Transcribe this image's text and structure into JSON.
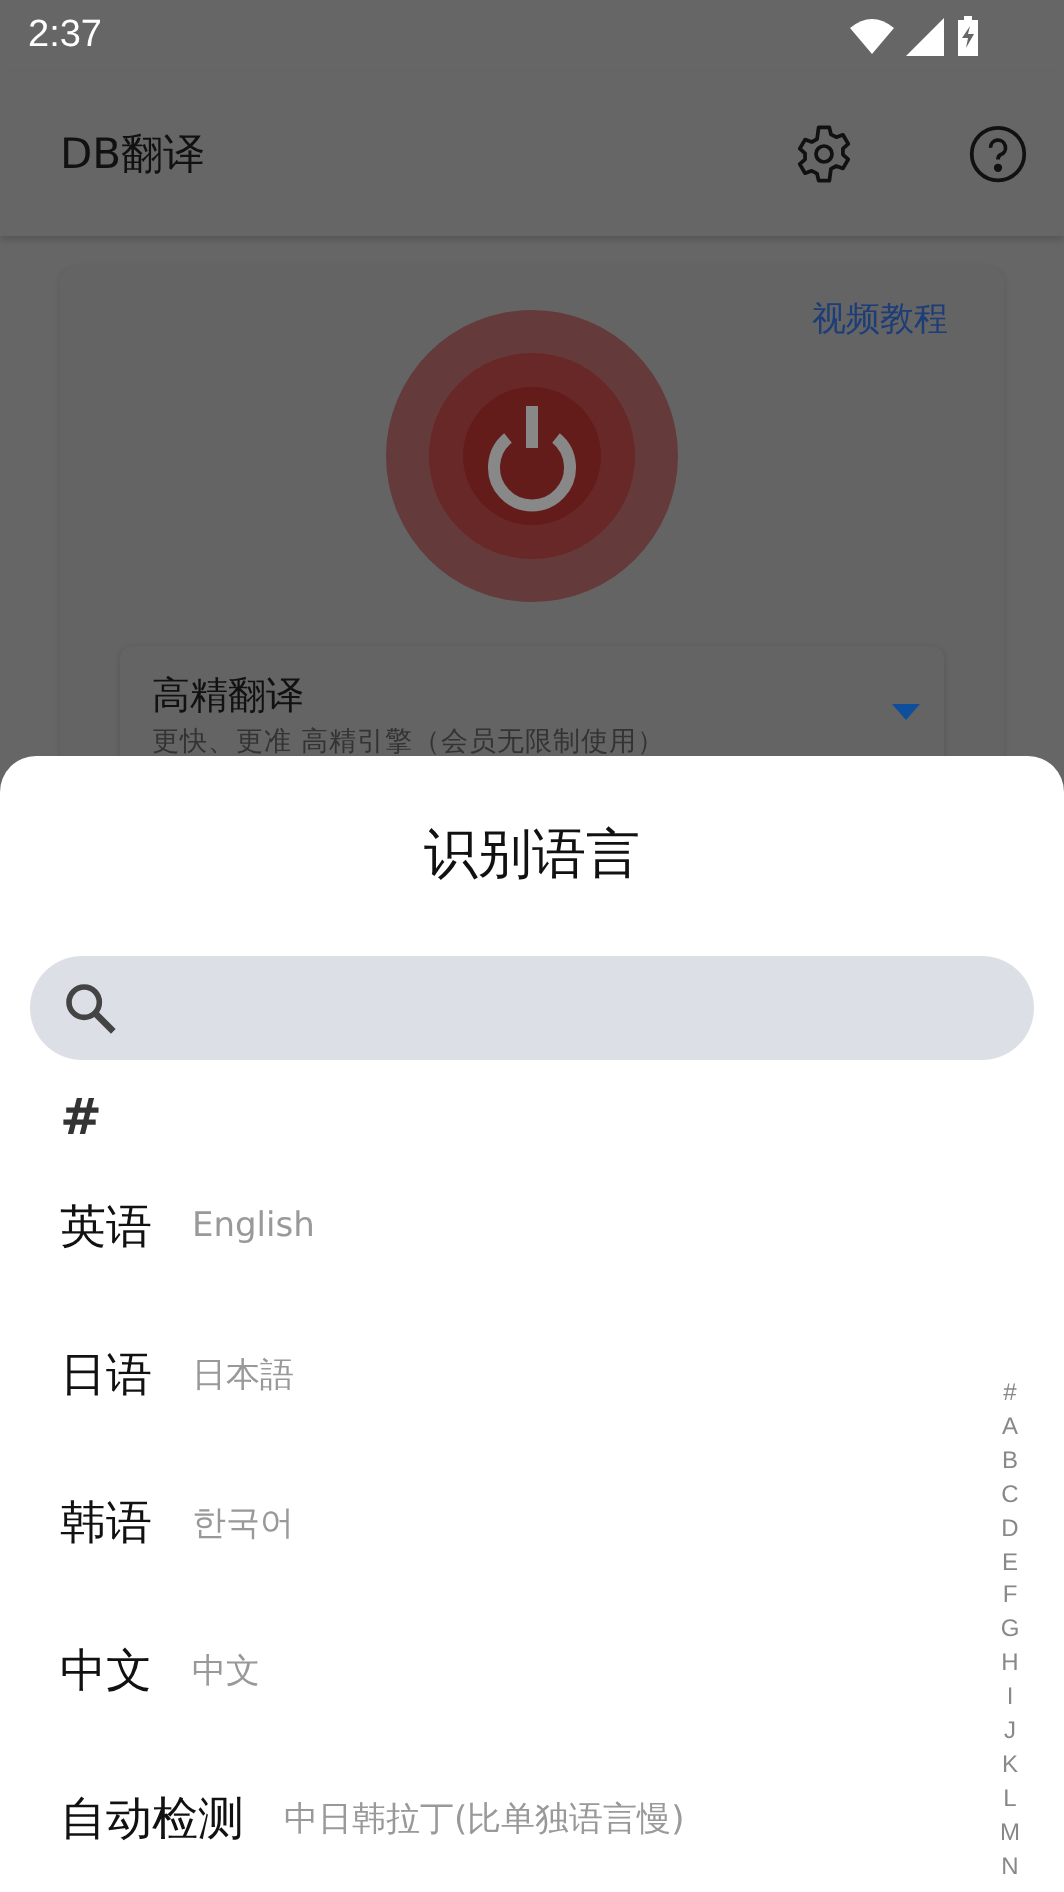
{
  "status_bar": {
    "time": "2:37"
  },
  "app_bar": {
    "title": "DB翻译"
  },
  "main_card": {
    "link": "视频教程",
    "mode_dropdown": {
      "title": "高精翻译",
      "subtitle": "更快、更准 高精引擎（会员无限制使用）"
    }
  },
  "sheet": {
    "title": "识别语言",
    "section_header": "#",
    "languages": [
      {
        "name": "英语",
        "native": "English"
      },
      {
        "name": "日语",
        "native": "日本語"
      },
      {
        "name": "韩语",
        "native": "한국어"
      },
      {
        "name": "中文",
        "native": "中文"
      },
      {
        "name": "自动检测",
        "native": "中日韩拉丁(比单独语言慢)"
      }
    ],
    "index": [
      "#",
      "A",
      "B",
      "C",
      "D",
      "E",
      "F",
      "G",
      "H",
      "I",
      "J",
      "K",
      "L",
      "M",
      "N"
    ]
  }
}
